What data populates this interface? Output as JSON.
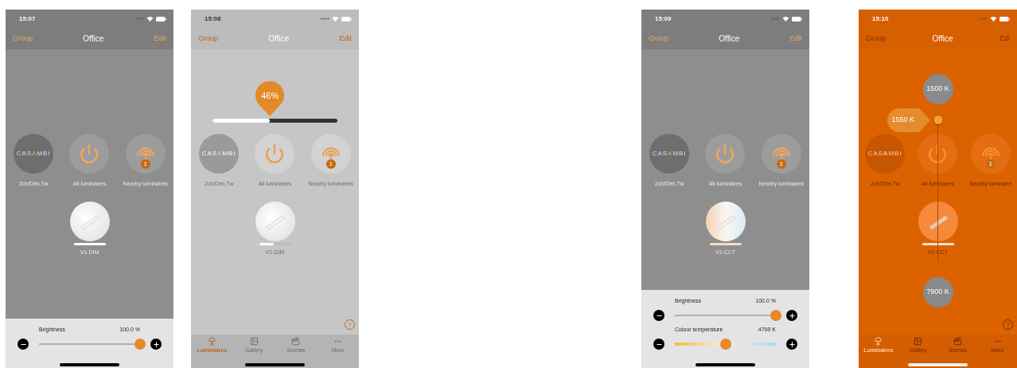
{
  "phones": [
    {
      "time": "15:07",
      "nav": {
        "left": "Group",
        "title": "Office",
        "right": "Edit"
      },
      "tiles": [
        {
          "kind": "logo",
          "logo": [
            {
              "text": "CAS",
              "accent": false
            },
            {
              "text": "A",
              "accent": true
            },
            {
              "text": "MBI",
              "accent": false
            }
          ],
          "label": "2ch/Dim,Tw"
        },
        {
          "kind": "power",
          "label": "All luminaires"
        },
        {
          "kind": "nearby",
          "badge": "1",
          "label": "Nearby luminaires"
        }
      ],
      "luminaire": {
        "kind": "dim",
        "name": "V1-DIM",
        "level": 1
      },
      "bottom": {
        "kind": "sliders",
        "sliders": [
          {
            "kind": "brightness",
            "label": "Brightness",
            "reading": "100.0 %",
            "level": 1
          }
        ]
      }
    },
    {
      "time": "15:08",
      "nav": {
        "left": "Group",
        "title": "Office",
        "right": "Edit"
      },
      "tiles": [
        {
          "kind": "logo",
          "logo": [
            {
              "text": "CAS",
              "accent": false
            },
            {
              "text": "A",
              "accent": true
            },
            {
              "text": "MBI",
              "accent": false
            }
          ],
          "label": "2ch/Dim,Tw"
        },
        {
          "kind": "power",
          "label": "All luminaires"
        },
        {
          "kind": "nearby",
          "badge": "1",
          "label": "Nearby luminaires"
        }
      ],
      "luminaire": {
        "kind": "dim",
        "name": "V1-DIM",
        "level": 0.46
      },
      "bottom": {
        "kind": "tabs",
        "help": "?",
        "tabs": [
          {
            "kind": "lamp",
            "label": "Luminaires",
            "selected": true
          },
          {
            "kind": "gallery",
            "label": "Gallery",
            "selected": false
          },
          {
            "kind": "scenes",
            "label": "Scenes",
            "selected": false
          },
          {
            "kind": "more",
            "label": "More",
            "selected": false
          }
        ]
      },
      "overlay": {
        "kind": "dimmer",
        "reading": "46%",
        "level": 0.46
      }
    },
    {
      "time": "15:09",
      "nav": {
        "left": "Group",
        "title": "Office",
        "right": "Edit"
      },
      "tiles": [
        {
          "kind": "logo",
          "logo": [
            {
              "text": "CAS",
              "accent": false
            },
            {
              "text": "A",
              "accent": true
            },
            {
              "text": "MBI",
              "accent": false
            }
          ],
          "label": "2ch/Dim,Tw"
        },
        {
          "kind": "power",
          "label": "All luminaires"
        },
        {
          "kind": "nearby",
          "badge": "1",
          "label": "Nearby luminaires"
        }
      ],
      "luminaire": {
        "kind": "cct",
        "name": "V2-CCT",
        "level": 1
      },
      "bottom": {
        "kind": "sliders",
        "sliders": [
          {
            "kind": "brightness",
            "label": "Brightness",
            "reading": "100.0 %",
            "level": 1
          },
          {
            "kind": "temperature",
            "label": "Colour temperature",
            "reading": "4700 K",
            "level": 0.5
          }
        ]
      }
    },
    {
      "time": "15:10",
      "nav": {
        "left": "Group",
        "title": "Office",
        "right": "Edi"
      },
      "tiles": [
        {
          "kind": "logo",
          "logo": [
            {
              "text": "CAS",
              "accent": false
            },
            {
              "text": "A",
              "accent": true
            },
            {
              "text": "MBI",
              "accent": false
            }
          ],
          "label": "2ch/Dim,Tw"
        },
        {
          "kind": "power",
          "label": "All luminaires"
        },
        {
          "kind": "nearby",
          "badge": "1",
          "label": "Nearby luminaire"
        }
      ],
      "luminaire": {
        "kind": "cct",
        "name": "V2-CCT",
        "level": 1
      },
      "bottom": {
        "kind": "tabs",
        "help": "?",
        "tabs": [
          {
            "kind": "lamp",
            "label": "Luminaires",
            "selected": true
          },
          {
            "kind": "gallery",
            "label": "Gallery",
            "selected": false
          },
          {
            "kind": "scenes",
            "label": "Scenes",
            "selected": false
          },
          {
            "kind": "more",
            "label": "More",
            "selected": false
          }
        ]
      },
      "overlay": {
        "kind": "temperature",
        "min": "1500 K",
        "reading": "1550 K",
        "max": "7900 K",
        "level": 0.01
      }
    }
  ]
}
